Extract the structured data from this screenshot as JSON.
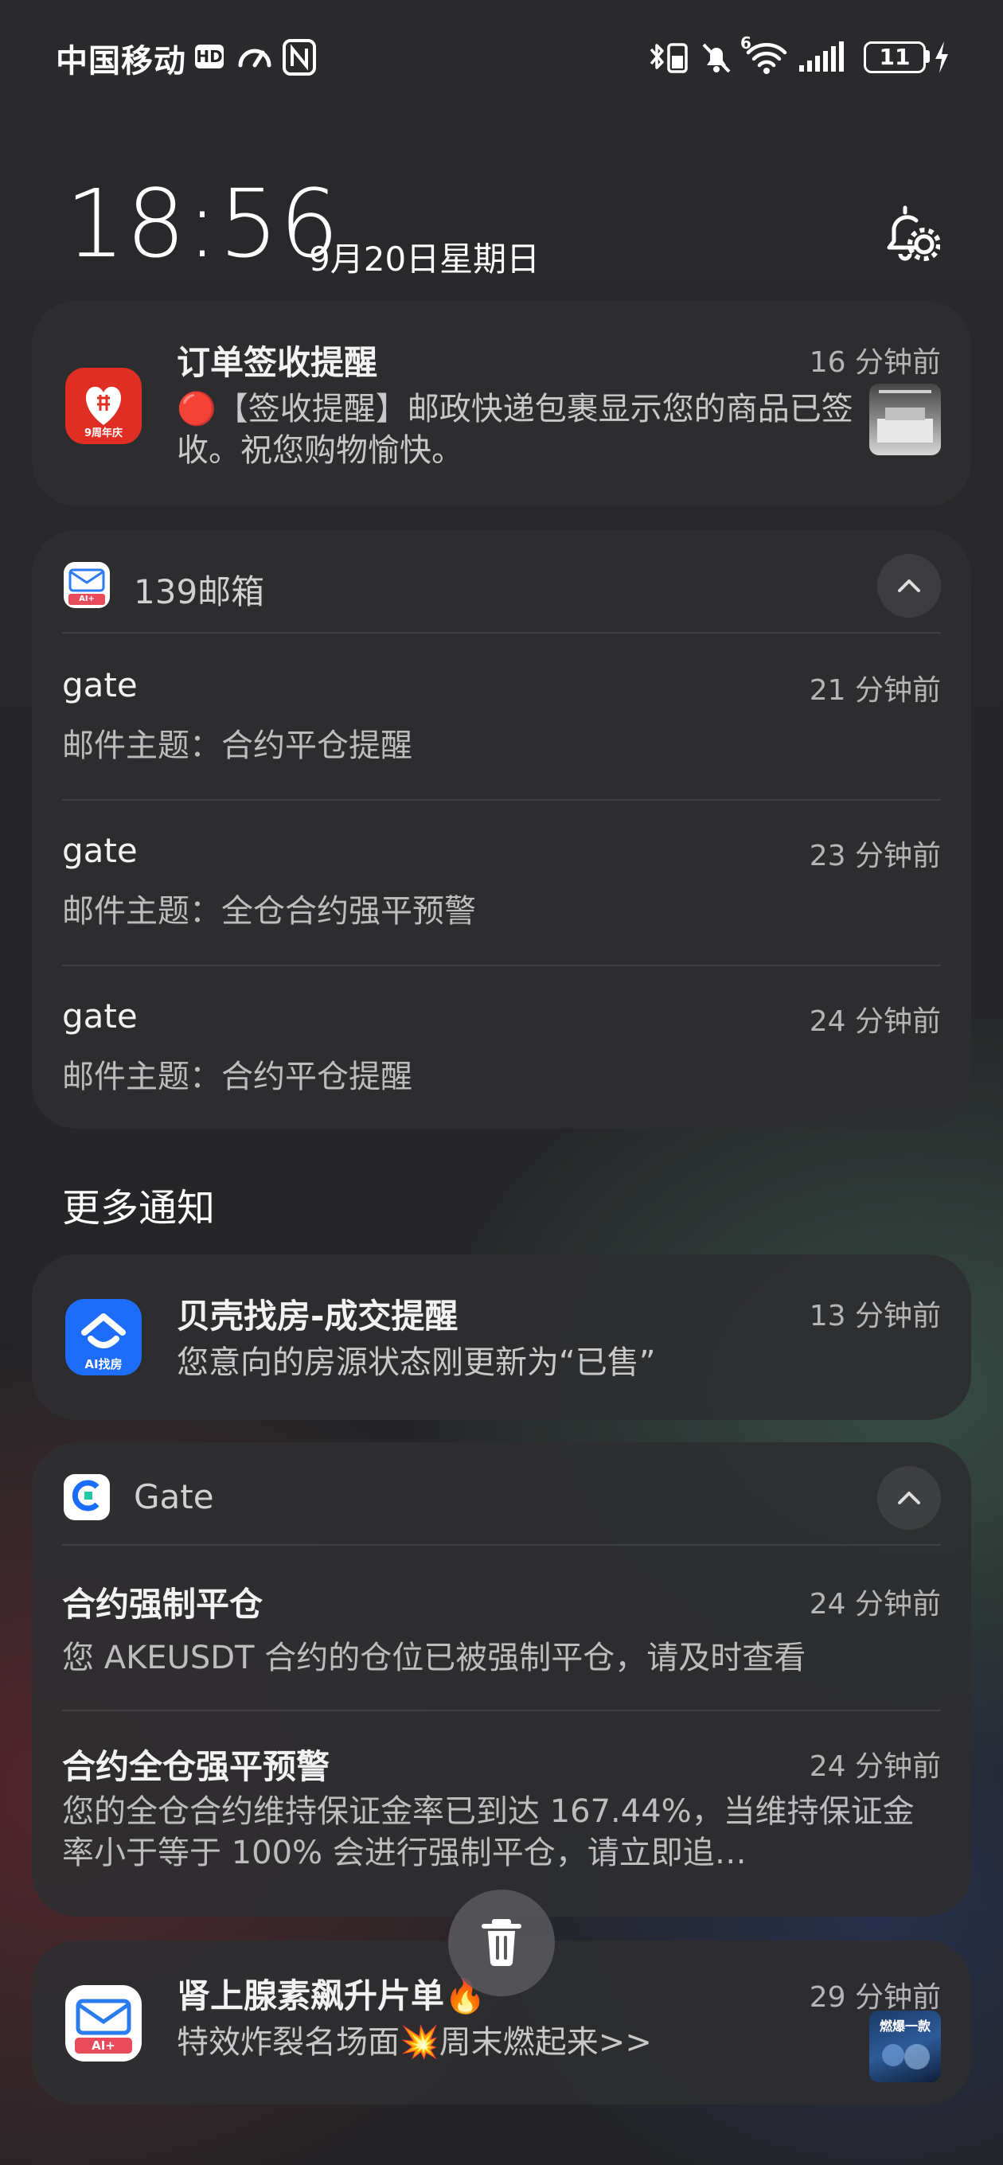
{
  "status_bar": {
    "carrier": "中国移动",
    "hd": "HD",
    "network_gen": "6",
    "battery": "11"
  },
  "header": {
    "time": "18:56",
    "date": "9月20日星期日"
  },
  "pdd_notification": {
    "title": "订单签收提醒",
    "time": "16 分钟前",
    "body": "🔴【签收提醒】邮政快递包裹显示您的商品已签收。祝您购物愉快。",
    "icon_caption": "9周年庆"
  },
  "mail139_group": {
    "app_name": "139邮箱",
    "icon_caption": "AI+",
    "items": [
      {
        "sender": "gate",
        "time": "21 分钟前",
        "subject": "邮件主题：合约平仓提醒"
      },
      {
        "sender": "gate",
        "time": "23 分钟前",
        "subject": "邮件主题：全仓合约强平预警"
      },
      {
        "sender": "gate",
        "time": "24 分钟前",
        "subject": "邮件主题：合约平仓提醒"
      }
    ]
  },
  "more_section_label": "更多通知",
  "beike_notification": {
    "title": "贝壳找房-成交提醒",
    "time": "13 分钟前",
    "body": "您意向的房源状态刚更新为“已售”",
    "icon_caption": "AI找房"
  },
  "gate_group": {
    "app_name": "Gate",
    "items": [
      {
        "title": "合约强制平仓",
        "time": "24 分钟前",
        "body": "您 AKEUSDT 合约的仓位已被强制平仓，请及时查看"
      },
      {
        "title": "合约全仓强平预警",
        "time": "24 分钟前",
        "body": "您的全仓合约维持保证金率已到达 167.44%，当维持保证金率小于等于 100% 会进行强制平仓，请立即追…"
      }
    ]
  },
  "mail139_promo": {
    "title": "肾上腺素飙升片单🔥",
    "time": "29 分钟前",
    "body": "特效炸裂名场面💥周末燃起来>>",
    "icon_caption": "AI+",
    "thumb_text": "燃爆一款"
  },
  "colors": {
    "pdd_red": "#e02e24",
    "beike_blue": "#1e6dfa",
    "gate_blue": "#1a6cff",
    "mail_red": "#e84b5c"
  }
}
